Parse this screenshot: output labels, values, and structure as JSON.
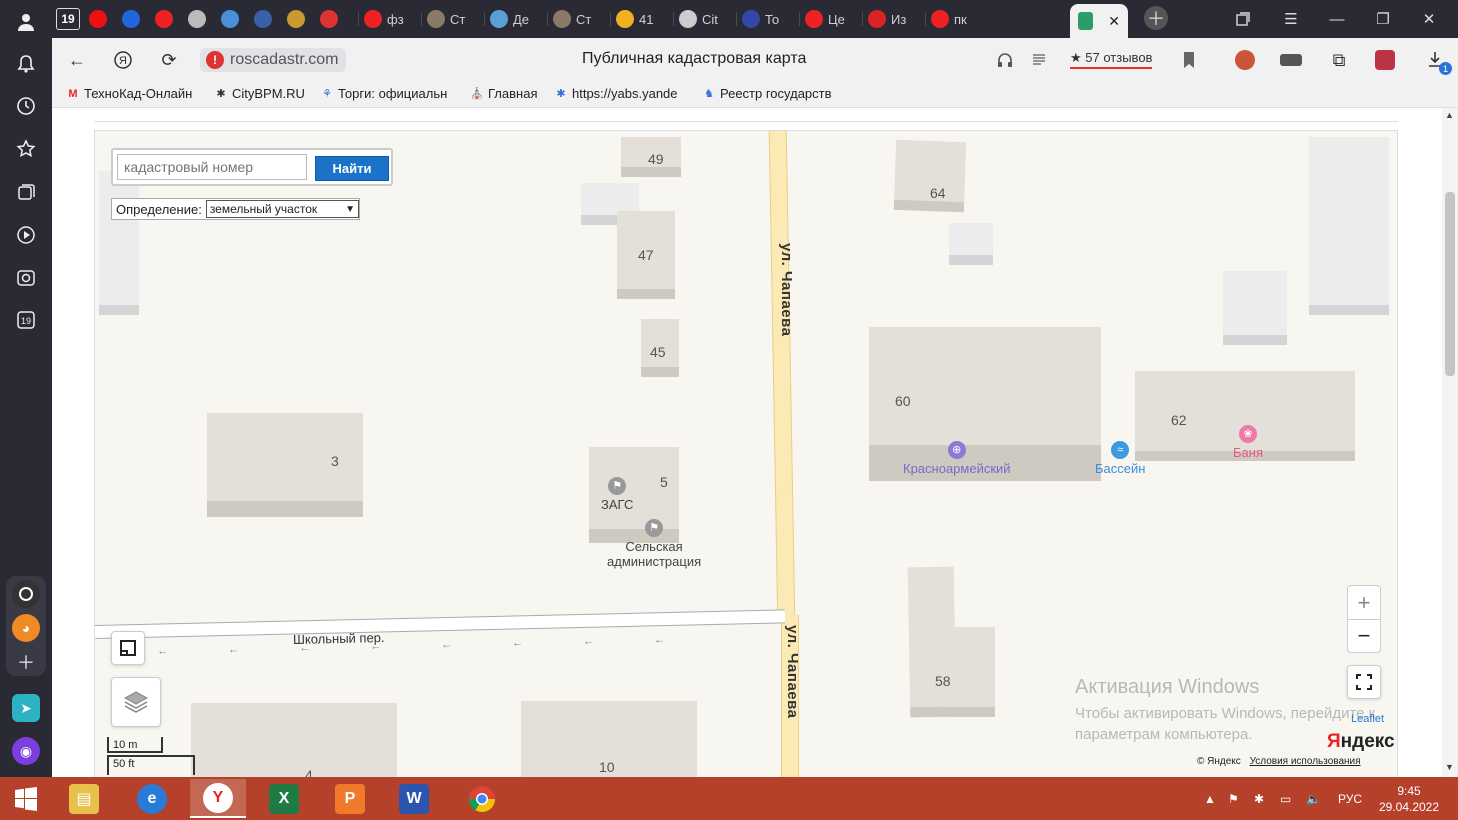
{
  "browser": {
    "tabs": [
      {
        "label": "19",
        "color": "#2a2a34"
      },
      {
        "label": "",
        "color": "#e11"
      },
      {
        "label": "",
        "color": "#2266dd"
      },
      {
        "label": "",
        "color": "#e22"
      },
      {
        "label": "",
        "color": "#bbb"
      },
      {
        "label": "",
        "color": "#4a90d9"
      },
      {
        "label": "",
        "color": "#3b5fa8"
      },
      {
        "label": "",
        "color": "#c93"
      },
      {
        "label": "",
        "color": "#d33"
      },
      {
        "label": "фз",
        "color": "#e22"
      },
      {
        "label": "Ст",
        "color": "#8a7a66"
      },
      {
        "label": "Де",
        "color": "#5aa0d8"
      },
      {
        "label": "Ст",
        "color": "#8a7a66"
      },
      {
        "label": "41",
        "color": "#f0b020"
      },
      {
        "label": "Cit",
        "color": "#ccc"
      },
      {
        "label": "То",
        "color": "#3347a8"
      },
      {
        "label": "Це",
        "color": "#e22"
      },
      {
        "label": "Из",
        "color": "#d22"
      },
      {
        "label": "пк",
        "color": "#e22"
      }
    ],
    "active_tab_favicon_color": "#2a9d6a",
    "url": "roscadastr.com",
    "page_title": "Публичная кадастровая карта",
    "reviews": "57 отзывов",
    "download_badge": "1",
    "bookmarks": [
      {
        "label": "ТехноКад-Онлайн",
        "icon": "M"
      },
      {
        "label": "CityBPM.RU",
        "icon": "✱"
      },
      {
        "label": "Торги: официальн",
        "icon": "⚘"
      },
      {
        "label": "Главная",
        "icon": "⛪"
      },
      {
        "label": "https://yabs.yande",
        "icon": "✱"
      },
      {
        "label": "Реестр государств",
        "icon": "♞"
      }
    ]
  },
  "map": {
    "search_placeholder": "кадастровый номер",
    "search_button": "Найти",
    "definition_label": "Определение:",
    "definition_value": "земельный участок",
    "street_names": {
      "chapaeva_top": "ул. Чапаева",
      "chapaeva_bottom": "ул. Чапаева",
      "shkolny": "Школьный пер."
    },
    "house_numbers": [
      "49",
      "47",
      "45",
      "64",
      "60",
      "62",
      "3",
      "5",
      "58",
      "10",
      "4"
    ],
    "pois": {
      "zags": "ЗАГС",
      "admin_line1": "Сельская",
      "admin_line2": "администрация",
      "krasnoarm": "Красноармейский",
      "pool": "Бассейн",
      "banya": "Баня"
    },
    "zoom_in": "+",
    "zoom_out": "−",
    "scale_m": "10 m",
    "scale_ft": "50 ft",
    "leaflet": "Leaflet",
    "yandex_logo_y": "Я",
    "yandex_logo_rest": "ндекс",
    "copyright": "© Яндекс",
    "terms": "Условия использования",
    "watermark_title": "Активация Windows",
    "watermark_sub": "Чтобы активировать Windows, перейдите к параметрам компьютера."
  },
  "taskbar": {
    "language": "РУС",
    "time": "9:45",
    "date": "29.04.2022"
  }
}
